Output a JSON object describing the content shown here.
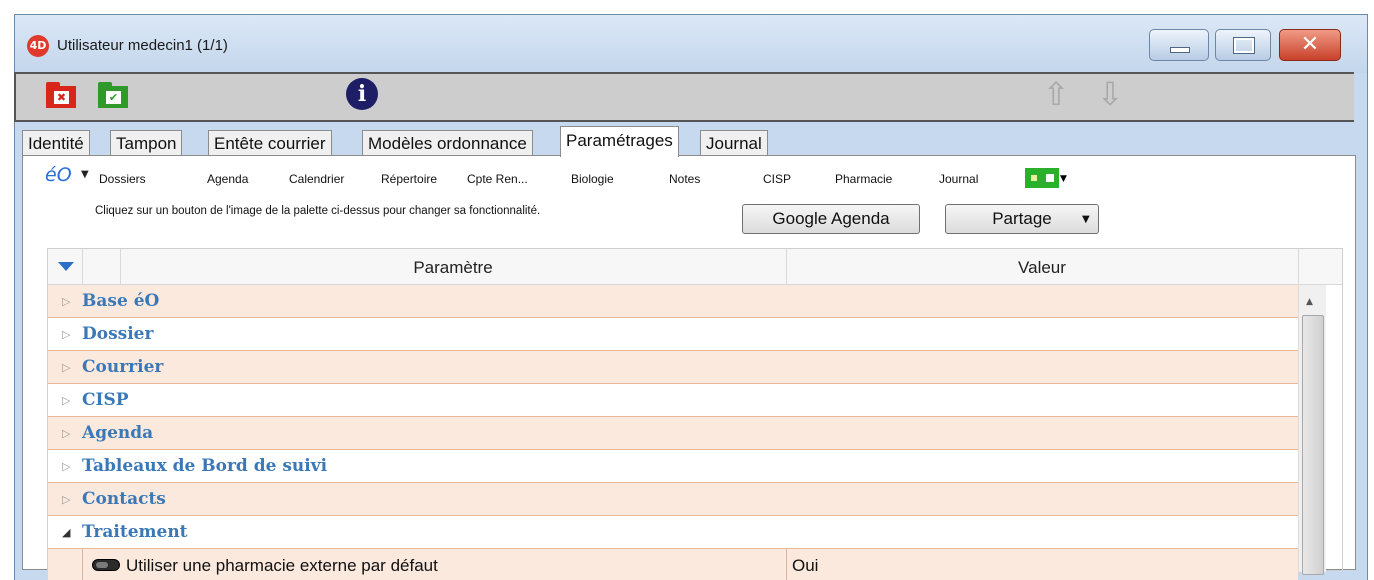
{
  "window": {
    "title": "Utilisateur medecin1 (1/1)",
    "app_icon_text": "4D",
    "controls": {
      "minimize": "minimize-icon",
      "maximize": "maximize-icon",
      "close": "✕"
    }
  },
  "toolbar": {
    "cancel_icon": "red-folder-cancel-icon",
    "cancel_mark": "✖",
    "validate_icon": "green-folder-check-icon",
    "validate_mark": "✔",
    "info_label": "i",
    "up_arrow": "⇧",
    "down_arrow": "⇩"
  },
  "tabs": [
    {
      "label": "Identité",
      "active": false
    },
    {
      "label": "Tampon",
      "active": false
    },
    {
      "label": "Entête courrier",
      "active": false
    },
    {
      "label": "Modèles ordonnance",
      "active": false
    },
    {
      "label": "Paramétrages",
      "active": true
    },
    {
      "label": "Journal",
      "active": false
    }
  ],
  "palette": {
    "logo": "éO",
    "items": [
      "Dossiers",
      "Agenda",
      "Calendrier",
      "Répertoire",
      "Cpte Ren...",
      "Biologie",
      "Notes",
      "CISP",
      "Pharmacie",
      "Journal"
    ],
    "hint": "Cliquez sur un bouton de l'image de la palette ci-dessus pour changer sa fonctionnalité.",
    "google_button": "Google Agenda",
    "partage_button": "Partage"
  },
  "grid": {
    "columns": [
      "Paramètre",
      "Valeur"
    ],
    "groups": [
      {
        "label": "Base éO",
        "expanded": false
      },
      {
        "label": "Dossier",
        "expanded": false
      },
      {
        "label": "Courrier",
        "expanded": false
      },
      {
        "label": "CISP",
        "expanded": false
      },
      {
        "label": "Agenda",
        "expanded": false
      },
      {
        "label": "Tableaux de Bord de suivi",
        "expanded": false
      },
      {
        "label": "Contacts",
        "expanded": false
      },
      {
        "label": "Traitement",
        "expanded": true
      }
    ],
    "child_row": {
      "label": "Utiliser une pharmacie externe par défaut",
      "value": "Oui"
    }
  },
  "colors": {
    "accent_blue": "#3a78b8",
    "row_tint": "#fbe9de",
    "close_red": "#c8402a"
  }
}
